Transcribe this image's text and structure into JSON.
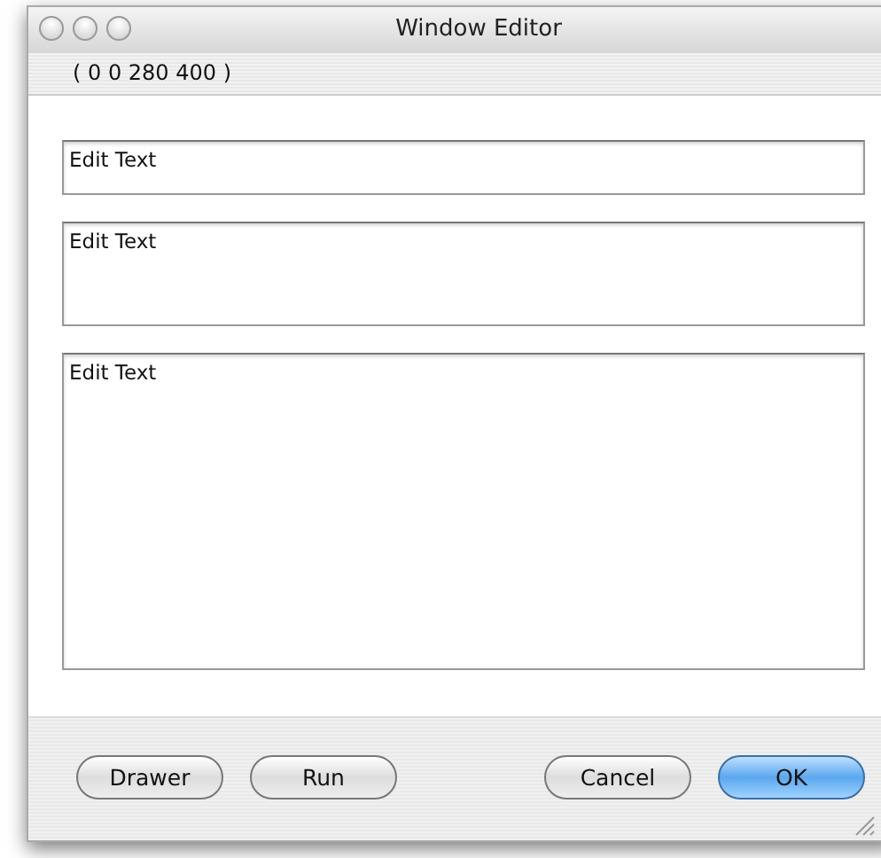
{
  "window": {
    "title": "Window Editor"
  },
  "coordinates": "( 0 0 280 400 )",
  "fields": [
    {
      "value": "Edit Text"
    },
    {
      "value": "Edit Text"
    },
    {
      "value": "Edit Text"
    }
  ],
  "buttons": [
    {
      "label": "Drawer",
      "default": false
    },
    {
      "label": "Run",
      "default": false
    },
    {
      "label": "Cancel",
      "default": false
    },
    {
      "label": "OK",
      "default": true
    }
  ]
}
